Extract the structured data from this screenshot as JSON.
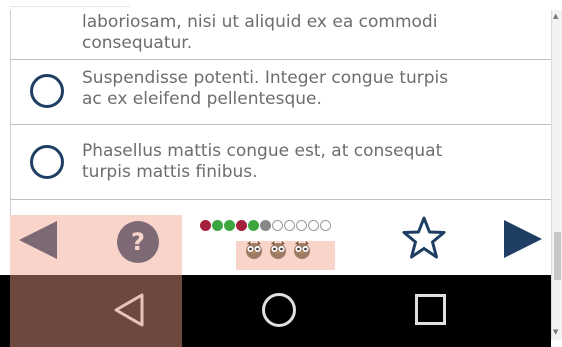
{
  "options": [
    {
      "text": "laboriosam, nisi ut aliquid ex ea commodi\nconsequatur.",
      "radio": false
    },
    {
      "text": "Suspendisse potenti. Integer congue turpis\nac ex eleifend pellentesque.",
      "radio": true
    },
    {
      "text": "Phasellus mattis congue est, at consequat\nturpis mattis finibus.",
      "radio": true
    }
  ],
  "toolbar": {
    "prev_icon": "previous-arrow-icon",
    "help_label": "?",
    "star_icon": "star-icon",
    "next_icon": "next-arrow-icon"
  },
  "progress": {
    "dots": [
      "#a3213b",
      "#3aa63f",
      "#3aa63f",
      "#a3213b",
      "#3aa63f",
      "#888888",
      "empty",
      "empty",
      "empty",
      "empty",
      "empty"
    ],
    "owls": 3
  },
  "navbar": {
    "back_icon": "back-icon",
    "home_icon": "home-icon",
    "recents_icon": "recents-icon"
  },
  "colors": {
    "accent": "#1f3e63",
    "option_text": "#6d6d6d",
    "highlight": "#f2a08c"
  }
}
